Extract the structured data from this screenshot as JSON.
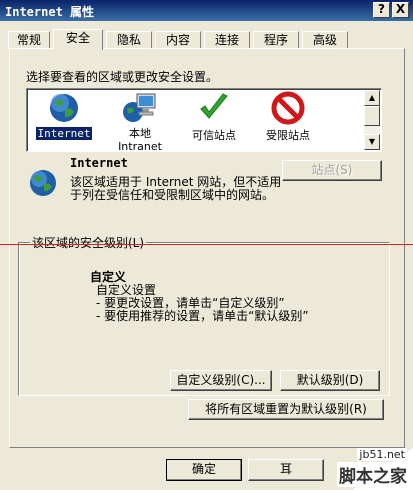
{
  "window": {
    "title": "Internet 属性",
    "help_button": "?",
    "close_button": "X"
  },
  "tabs": [
    {
      "label": "常规"
    },
    {
      "label": "安全"
    },
    {
      "label": "隐私"
    },
    {
      "label": "内容"
    },
    {
      "label": "连接"
    },
    {
      "label": "程序"
    },
    {
      "label": "高级"
    }
  ],
  "active_tab": "安全",
  "security": {
    "instruction": "选择要查看的区域或更改安全设置。",
    "zones": [
      {
        "label": "Internet",
        "icon": "globe-icon",
        "selected": true
      },
      {
        "label": "本地\nIntranet",
        "icon": "intranet-icon",
        "selected": false
      },
      {
        "label": "可信站点",
        "icon": "checkmark-icon",
        "selected": false
      },
      {
        "label": "受限站点",
        "icon": "no-entry-icon",
        "selected": false
      }
    ],
    "zone_title": "Internet",
    "zone_description": "该区域适用于 Internet 网站，但不适用于列在受信任和受限制区域中的网站。",
    "sites_button": "站点(S)",
    "group_label": "该区域的安全级别(L)",
    "level_title": "自定义",
    "level_line1": "自定义设置",
    "level_line2": "- 要更改设置，请单击“自定义级别”",
    "level_line3": "- 要使用推荐的设置，请单击“默认级别”",
    "custom_level_button": "自定义级别(C)...",
    "default_level_button": "默认级别(D)",
    "reset_all_button": "将所有区域重置为默认级别(R)"
  },
  "footer": {
    "ok_button": "确定",
    "cancel_button_partial": "耳"
  },
  "watermark": {
    "line1": "jb51.net",
    "line2": "脚本之家"
  },
  "colors": {
    "title_bar": "#0a246a",
    "face": "#ece9d8",
    "selection": "#0a246a",
    "red_guide_line": "#e02020"
  }
}
